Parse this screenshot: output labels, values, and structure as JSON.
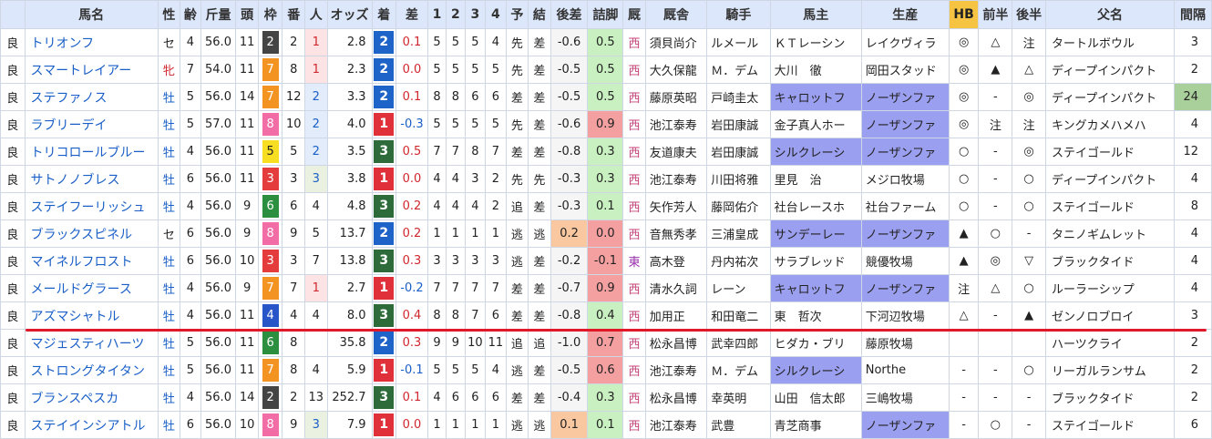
{
  "headers": [
    "",
    "馬名",
    "性",
    "齢",
    "斤量",
    "頭",
    "枠",
    "番",
    "人",
    "オッズ",
    "着",
    "差",
    "1",
    "2",
    "3",
    "4",
    "予",
    "結",
    "後差",
    "詰脚",
    "厩",
    "厩舎",
    "騎手",
    "馬主",
    "生産",
    "HB",
    "前半",
    "後半",
    "父名",
    "間隔"
  ],
  "rows": [
    {
      "baba": "良",
      "name": "トリオンフ",
      "sex": "セ",
      "age": "4",
      "kin": "56.0",
      "tou": "11",
      "waku": "2",
      "ban": "2",
      "ninki": "1",
      "odds": "2.8",
      "chaku": "2",
      "sa": "0.1",
      "c1": "5",
      "c2": "5",
      "c3": "5",
      "c4": "4",
      "yo": "先",
      "ke": "差",
      "kosa": "-0.6",
      "tsume": "0.5",
      "zai": "西",
      "kyu": "須貝尚介",
      "jockey": "ルメール",
      "owner": "ＫＴレーシン",
      "seisan": "レイクヴィラ",
      "hb": "◎",
      "zen": "△",
      "kou": "注",
      "sire": "タートルボウル",
      "kankaku": "3"
    },
    {
      "baba": "良",
      "name": "スマートレイアー",
      "sex": "牝",
      "age": "7",
      "kin": "54.0",
      "tou": "11",
      "waku": "7",
      "ban": "8",
      "ninki": "1",
      "odds": "2.3",
      "chaku": "2",
      "sa": "0.0",
      "c1": "5",
      "c2": "5",
      "c3": "5",
      "c4": "5",
      "yo": "先",
      "ke": "差",
      "kosa": "-0.5",
      "tsume": "0.5",
      "zai": "西",
      "kyu": "大久保龍",
      "jockey": "Ｍ．デム",
      "owner": "大川　徹",
      "seisan": "岡田スタッド",
      "hb": "◎",
      "zen": "▲",
      "kou": "△",
      "sire": "ディープインパクト",
      "kankaku": "2"
    },
    {
      "baba": "良",
      "name": "ステファノス",
      "sex": "牡",
      "age": "5",
      "kin": "56.0",
      "tou": "14",
      "waku": "7",
      "ban": "12",
      "ninki": "2",
      "odds": "3.3",
      "chaku": "2",
      "sa": "0.1",
      "c1": "8",
      "c2": "8",
      "c3": "6",
      "c4": "6",
      "yo": "差",
      "ke": "差",
      "kosa": "-0.5",
      "tsume": "0.5",
      "zai": "西",
      "kyu": "藤原英昭",
      "jockey": "戸崎圭太",
      "owner": "キャロットフ",
      "seisan": "ノーザンファ",
      "hb": "◎",
      "zen": "-",
      "kou": "◎",
      "sire": "ディープインパクト",
      "kankaku": "24"
    },
    {
      "baba": "良",
      "name": "ラブリーデイ",
      "sex": "牡",
      "age": "5",
      "kin": "57.0",
      "tou": "11",
      "waku": "8",
      "ban": "10",
      "ninki": "2",
      "odds": "4.0",
      "chaku": "1",
      "sa": "-0.3",
      "c1": "5",
      "c2": "5",
      "c3": "5",
      "c4": "5",
      "yo": "先",
      "ke": "差",
      "kosa": "-0.6",
      "tsume": "0.9",
      "zai": "西",
      "kyu": "池江泰寿",
      "jockey": "岩田康誠",
      "owner": "金子真人ホー",
      "seisan": "ノーザンファ",
      "hb": "◎",
      "zen": "注",
      "kou": "注",
      "sire": "キングカメハメハ",
      "kankaku": "4"
    },
    {
      "baba": "良",
      "name": "トリコロールブルー",
      "sex": "牡",
      "age": "4",
      "kin": "56.0",
      "tou": "11",
      "waku": "5",
      "ban": "5",
      "ninki": "2",
      "odds": "3.5",
      "chaku": "3",
      "sa": "0.5",
      "c1": "7",
      "c2": "7",
      "c3": "8",
      "c4": "7",
      "yo": "差",
      "ke": "差",
      "kosa": "-0.8",
      "tsume": "0.3",
      "zai": "西",
      "kyu": "友道康夫",
      "jockey": "岩田康誠",
      "owner": "シルクレーシ",
      "seisan": "ノーザンファ",
      "hb": "○",
      "zen": "-",
      "kou": "◎",
      "sire": "ステイゴールド",
      "kankaku": "12"
    },
    {
      "baba": "良",
      "name": "サトノノブレス",
      "sex": "牡",
      "age": "6",
      "kin": "56.0",
      "tou": "11",
      "waku": "3",
      "ban": "3",
      "ninki": "3",
      "odds": "3.8",
      "chaku": "1",
      "sa": "0.0",
      "c1": "4",
      "c2": "4",
      "c3": "3",
      "c4": "2",
      "yo": "先",
      "ke": "先",
      "kosa": "-0.3",
      "tsume": "0.3",
      "zai": "西",
      "kyu": "池江泰寿",
      "jockey": "川田将雅",
      "owner": "里見　治",
      "seisan": "メジロ牧場",
      "hb": "○",
      "zen": "-",
      "kou": "○",
      "sire": "ディープインパクト",
      "kankaku": "4"
    },
    {
      "baba": "良",
      "name": "ステイフーリッシュ",
      "sex": "牡",
      "age": "4",
      "kin": "56.0",
      "tou": "9",
      "waku": "6",
      "ban": "6",
      "ninki": "4",
      "odds": "4.8",
      "chaku": "3",
      "sa": "0.2",
      "c1": "4",
      "c2": "4",
      "c3": "4",
      "c4": "2",
      "yo": "追",
      "ke": "差",
      "kosa": "-0.3",
      "tsume": "0.1",
      "zai": "西",
      "kyu": "矢作芳人",
      "jockey": "藤岡佑介",
      "owner": "社台レースホ",
      "seisan": "社台ファーム",
      "hb": "○",
      "zen": "-",
      "kou": "○",
      "sire": "ステイゴールド",
      "kankaku": "8"
    },
    {
      "baba": "良",
      "name": "ブラックスピネル",
      "sex": "セ",
      "age": "6",
      "kin": "56.0",
      "tou": "9",
      "waku": "8",
      "ban": "9",
      "ninki": "5",
      "odds": "13.7",
      "chaku": "2",
      "sa": "0.2",
      "c1": "1",
      "c2": "1",
      "c3": "1",
      "c4": "1",
      "yo": "逃",
      "ke": "逃",
      "kosa": "0.2",
      "tsume": "0.0",
      "zai": "西",
      "kyu": "音無秀孝",
      "jockey": "三浦皇成",
      "owner": "サンデーレー",
      "seisan": "ノーザンファ",
      "hb": "▲",
      "zen": "○",
      "kou": "-",
      "sire": "タニノギムレット",
      "kankaku": "4"
    },
    {
      "baba": "良",
      "name": "マイネルフロスト",
      "sex": "牡",
      "age": "6",
      "kin": "56.0",
      "tou": "10",
      "waku": "3",
      "ban": "3",
      "ninki": "7",
      "odds": "13.8",
      "chaku": "3",
      "sa": "0.3",
      "c1": "3",
      "c2": "3",
      "c3": "3",
      "c4": "3",
      "yo": "逃",
      "ke": "差",
      "kosa": "-0.2",
      "tsume": "-0.1",
      "zai": "東",
      "kyu": "高木登",
      "jockey": "丹内祐次",
      "owner": "サラブレッド",
      "seisan": "競優牧場",
      "hb": "▲",
      "zen": "◎",
      "kou": "▽",
      "sire": "ブラックタイド",
      "kankaku": "4"
    },
    {
      "baba": "良",
      "name": "メールドグラース",
      "sex": "牡",
      "age": "4",
      "kin": "56.0",
      "tou": "9",
      "waku": "7",
      "ban": "7",
      "ninki": "1",
      "odds": "2.7",
      "chaku": "1",
      "sa": "-0.2",
      "c1": "7",
      "c2": "7",
      "c3": "7",
      "c4": "7",
      "yo": "差",
      "ke": "差",
      "kosa": "-0.7",
      "tsume": "0.9",
      "zai": "西",
      "kyu": "清水久詞",
      "jockey": "レーン",
      "owner": "キャロットフ",
      "seisan": "ノーザンファ",
      "hb": "注",
      "zen": "△",
      "kou": "○",
      "sire": "ルーラーシップ",
      "kankaku": "4"
    },
    {
      "baba": "良",
      "name": "アズマシャトル",
      "sex": "牡",
      "age": "4",
      "kin": "56.0",
      "tou": "11",
      "waku": "4",
      "ban": "4",
      "ninki": "4",
      "odds": "8.0",
      "chaku": "3",
      "sa": "0.4",
      "c1": "8",
      "c2": "8",
      "c3": "7",
      "c4": "6",
      "yo": "差",
      "ke": "差",
      "kosa": "-0.8",
      "tsume": "0.4",
      "zai": "西",
      "kyu": "加用正",
      "jockey": "和田竜二",
      "owner": "東　哲次",
      "seisan": "下河辺牧場",
      "hb": "△",
      "zen": "-",
      "kou": "▲",
      "sire": "ゼンノロブロイ",
      "kankaku": "3"
    },
    {
      "baba": "良",
      "name": "マジェスティハーツ",
      "sex": "牡",
      "age": "5",
      "kin": "56.0",
      "tou": "11",
      "waku": "6",
      "ban": "8",
      "ninki": "",
      "odds": "35.8",
      "chaku": "2",
      "sa": "0.3",
      "c1": "9",
      "c2": "9",
      "c3": "10",
      "c4": "11",
      "yo": "追",
      "ke": "追",
      "kosa": "-1.0",
      "tsume": "0.7",
      "zai": "西",
      "kyu": "松永昌博",
      "jockey": "武幸四郎",
      "owner": "ヒダカ・ブリ",
      "seisan": "藤原牧場",
      "hb": "",
      "zen": "",
      "kou": "",
      "sire": "ハーツクライ",
      "kankaku": "2"
    },
    {
      "baba": "良",
      "name": "ストロングタイタン",
      "sex": "牡",
      "age": "5",
      "kin": "56.0",
      "tou": "11",
      "waku": "7",
      "ban": "8",
      "ninki": "4",
      "odds": "5.9",
      "chaku": "1",
      "sa": "-0.1",
      "c1": "5",
      "c2": "5",
      "c3": "5",
      "c4": "4",
      "yo": "逃",
      "ke": "差",
      "kosa": "-0.5",
      "tsume": "0.6",
      "zai": "西",
      "kyu": "池江泰寿",
      "jockey": "Ｍ．デム",
      "owner": "シルクレーシ",
      "seisan": "Northe",
      "hb": "-",
      "zen": "-",
      "kou": "○",
      "sire": "リーガルランサム",
      "kankaku": "2"
    },
    {
      "baba": "良",
      "name": "ブランスペスカ",
      "sex": "牡",
      "age": "4",
      "kin": "56.0",
      "tou": "14",
      "waku": "2",
      "ban": "2",
      "ninki": "13",
      "odds": "252.7",
      "chaku": "3",
      "sa": "0.1",
      "c1": "4",
      "c2": "6",
      "c3": "6",
      "c4": "6",
      "yo": "差",
      "ke": "差",
      "kosa": "-0.4",
      "tsume": "0.3",
      "zai": "西",
      "kyu": "松永昌博",
      "jockey": "幸英明",
      "owner": "山田　信太郎",
      "seisan": "三嶋牧場",
      "hb": "-",
      "zen": "-",
      "kou": "-",
      "sire": "ブラックタイド",
      "kankaku": "2"
    },
    {
      "baba": "良",
      "name": "ステイインシアトル",
      "sex": "牡",
      "age": "6",
      "kin": "56.0",
      "tou": "10",
      "waku": "8",
      "ban": "9",
      "ninki": "3",
      "odds": "7.9",
      "chaku": "1",
      "sa": "0.0",
      "c1": "1",
      "c2": "1",
      "c3": "1",
      "c4": "1",
      "yo": "逃",
      "ke": "逃",
      "kosa": "0.1",
      "tsume": "0.1",
      "zai": "西",
      "kyu": "池江泰寿",
      "jockey": "武豊",
      "owner": "青芝商事",
      "seisan": "ノーザンファ",
      "hb": "-",
      "zen": "○",
      "kou": "-",
      "sire": "ステイゴールド",
      "kankaku": "6"
    }
  ]
}
